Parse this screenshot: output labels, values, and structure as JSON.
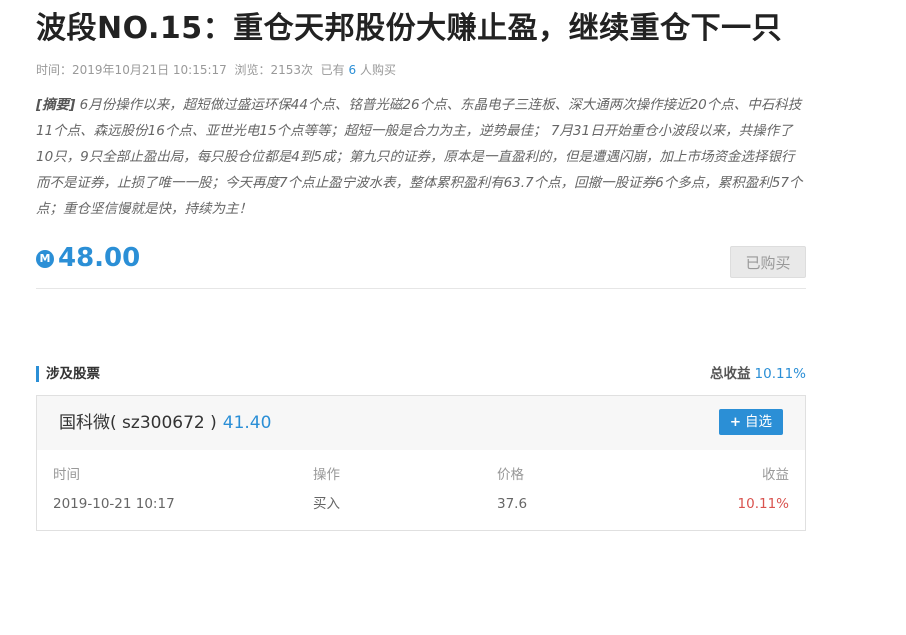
{
  "article": {
    "title": "波段NO.15：重仓天邦股份大赚止盈，继续重仓下一只",
    "meta_time_label": "时间：",
    "meta_time": "2019年10月21日 10:15:17",
    "meta_views_label": "浏览：",
    "meta_views": "2153次",
    "meta_buyers_prefix": "已有",
    "meta_buyers_count": "6",
    "meta_buyers_suffix": "人购买",
    "abstract_label": "[摘要]",
    "abstract_text": "6月份操作以来，超短做过盛运环保44个点、铭普光磁26个点、东晶电子三连板、深大通两次操作接近20个点、中石科技11个点、森远股份16个点、亚世光电15个点等等；超短一般是合力为主，逆势最佳； 7月31日开始重仓小波段以来，共操作了10只，9只全部止盈出局，每只股仓位都是4到5成；第九只的证券，原本是一直盈利的，但是遭遇闪崩，加上市场资金选择银行而不是证券，止损了唯一一股；今天再度7个点止盈宁波水表，整体累积盈利有63.7个点，回撤一股证券6个多点，累积盈利57个点；重仓坚信慢就是快，持续为主！"
  },
  "purchase": {
    "coin_icon_glyph": "M",
    "price": "48.00",
    "bought_label": "已购买"
  },
  "stocks_section": {
    "title": "涉及股票",
    "total_gain_label": "总收益",
    "total_gain_value": "10.11%"
  },
  "stock": {
    "name_text": "国科微( sz300672 )",
    "price": "41.40",
    "watch_plus": "+",
    "watch_label": "自选",
    "headers": [
      "时间",
      "操作",
      "价格",
      "收益"
    ],
    "rows": [
      [
        "2019-10-21 10:17",
        "买入",
        "37.6",
        "10.11%"
      ]
    ]
  },
  "colors": {
    "accent": "#2b8fd6",
    "gain_red": "#d9534f"
  }
}
